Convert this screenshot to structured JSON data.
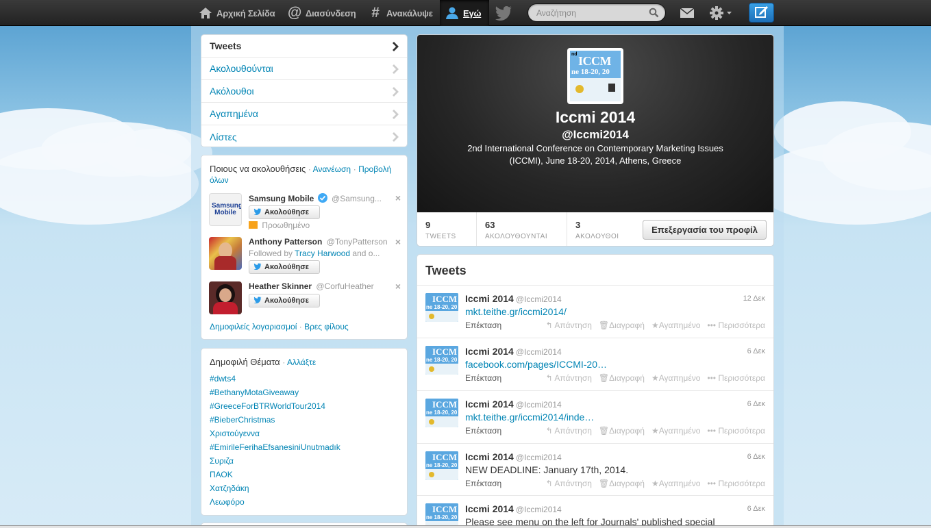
{
  "nav": {
    "home": "Αρχική Σελίδα",
    "connect": "Διασύνδεση",
    "discover": "Ανακάλυψε",
    "me": "Εγώ",
    "search_placeholder": "Αναζήτηση"
  },
  "sidebar_nav": [
    "Tweets",
    "Ακολουθούνται",
    "Ακόλουθοι",
    "Αγαπημένα",
    "Λίστες"
  ],
  "wtf": {
    "title": "Ποιους να ακολουθήσεις",
    "refresh": "Ανανέωση",
    "view_all": "Προβολή όλων",
    "follow_label": "Ακολούθησε",
    "items": [
      {
        "name": "Samsung Mobile",
        "screen": "@Samsung...",
        "sub": "Προωθημένο",
        "avatar_text": "Samsung Mobile"
      },
      {
        "name": "Anthony Patterson",
        "screen": "@TonyPatterson",
        "sub_prefix": "Followed by",
        "sub_link": "Tracy Harwood",
        "sub_suffix": "and o..."
      },
      {
        "name": "Heather Skinner",
        "screen": "@CorfuHeather"
      }
    ],
    "popular": "Δημοφιλείς λογαριασμοί",
    "find": "Βρες φίλους"
  },
  "trends": {
    "title": "Δημοφιλή Θέματα",
    "change": "Αλλάξτε",
    "items": [
      "#dwts4",
      "#BethanyMotaGiveaway",
      "#GreeceForBTRWorldTour2014",
      "#BieberChristmas",
      "Χριστούγεννα",
      "#EmirileFerihaEfsanesiniUnutmadık",
      "Συριζα",
      "ΠΑΟΚ",
      "Χατζηδάκη",
      "Λεωφόρο"
    ]
  },
  "profile": {
    "name": "Iccmi 2014",
    "screen": "@Iccmi2014",
    "bio_line1": "2nd International Conference on Contemporary Marketing Issues",
    "bio_line2": "(ICCMI), June 18-20, 2014, Athens, Greece",
    "avatar_text": "ICCM",
    "avatar_sub": "ne 18-20, 20",
    "stats": [
      {
        "n": "9",
        "l": "TWEETS"
      },
      {
        "n": "63",
        "l": "ΑΚΟΛΟΥΘΟΥΝΤΑΙ"
      },
      {
        "n": "3",
        "l": "ΑΚΟΛΟΥΘΟΙ"
      }
    ],
    "edit": "Επεξεργασία του προφίλ"
  },
  "timeline": {
    "title": "Tweets",
    "expand": "Επέκταση",
    "actions": [
      "Απάντηση",
      "Διαγραφή",
      "Αγαπημένο",
      "Περισσότερα"
    ],
    "tweets": [
      {
        "name": "Iccmi 2014",
        "screen": "@Iccmi2014",
        "time": "12 Δεκ",
        "text": "mkt.teithe.gr/iccmi2014/",
        "link": true
      },
      {
        "name": "Iccmi 2014",
        "screen": "@Iccmi2014",
        "time": "6 Δεκ",
        "text": "facebook.com/pages/ICCMI-20…",
        "link": true
      },
      {
        "name": "Iccmi 2014",
        "screen": "@Iccmi2014",
        "time": "6 Δεκ",
        "text": "mkt.teithe.gr/iccmi2014/inde…",
        "link": true
      },
      {
        "name": "Iccmi 2014",
        "screen": "@Iccmi2014",
        "time": "6 Δεκ",
        "text": "NEW DEADLINE: January 17th, 2014.",
        "link": false
      },
      {
        "name": "Iccmi 2014",
        "screen": "@Iccmi2014",
        "time": "6 Δεκ",
        "text": "Please see menu on the left for Journals' published special",
        "link": false
      }
    ]
  }
}
